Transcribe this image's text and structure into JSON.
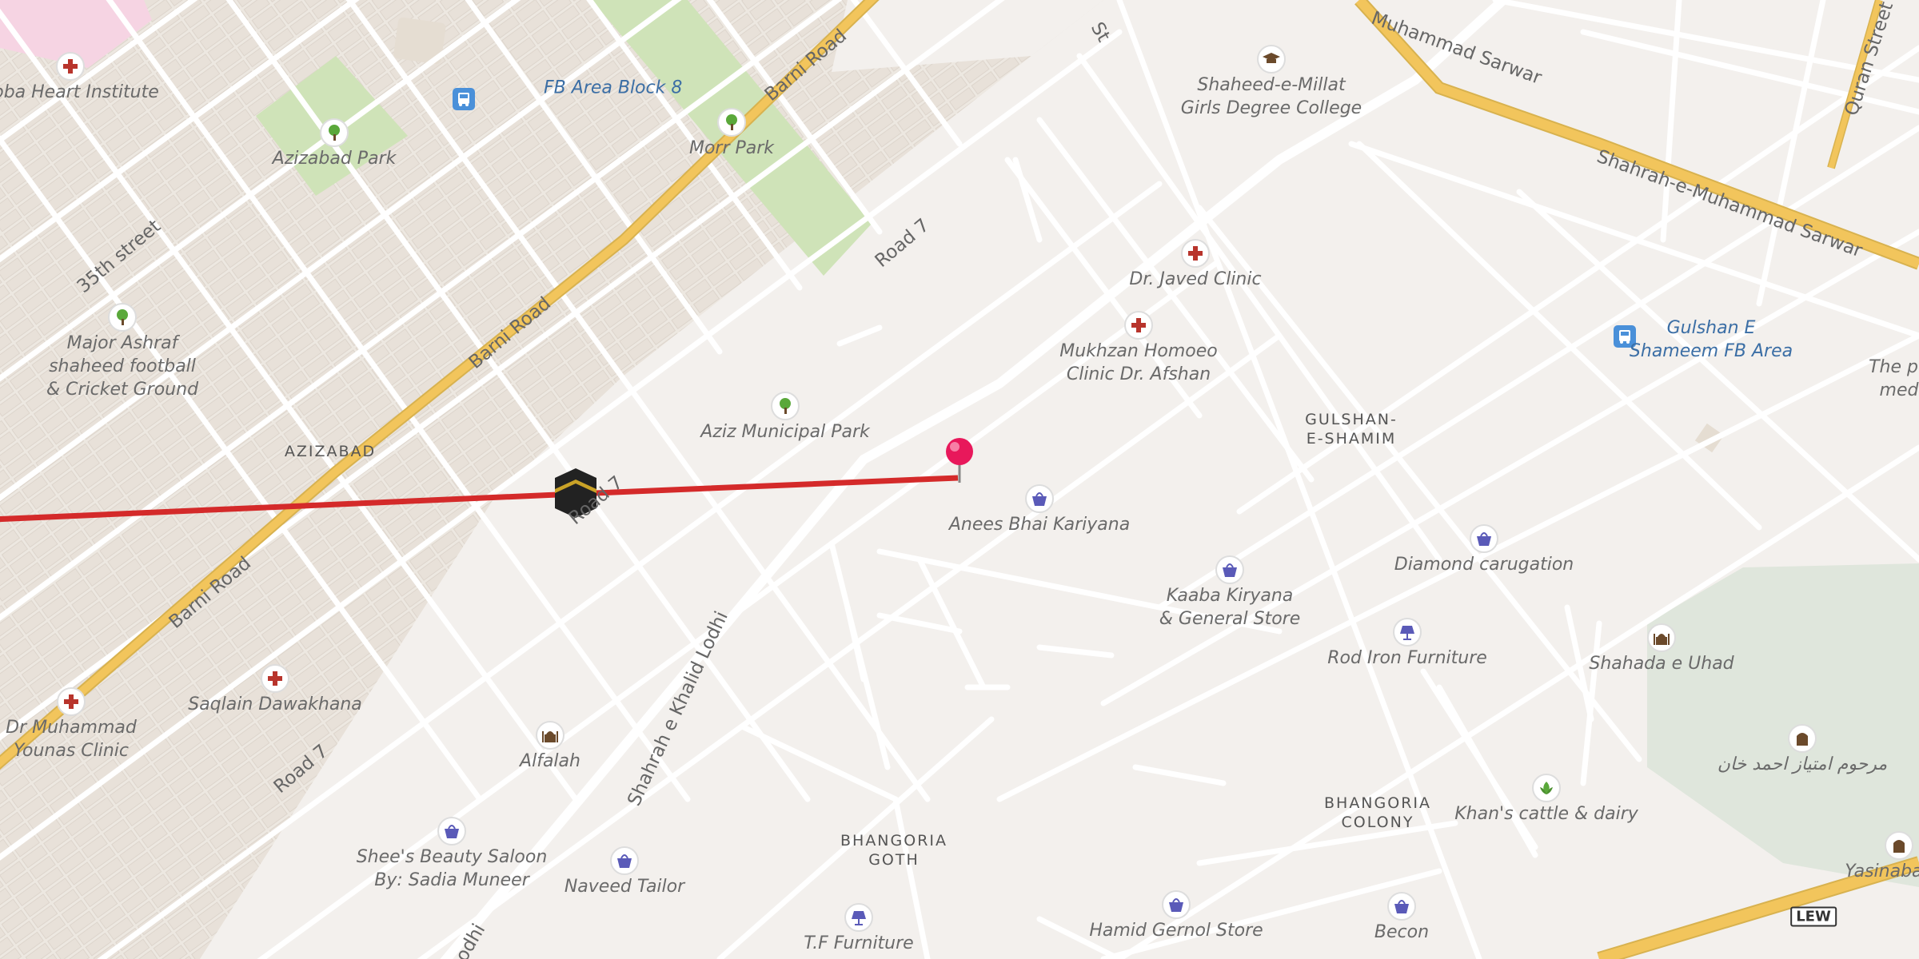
{
  "map": {
    "pois": [
      {
        "name": "heart-institute-icon",
        "type": "hospital",
        "label": "abba Heart Institute"
      },
      {
        "name": "fb-area-block8-icon",
        "type": "bus",
        "label": "FB Area Block 8"
      },
      {
        "name": "azizabad-park-icon",
        "type": "park",
        "label": "Azizabad Park"
      },
      {
        "name": "morr-park-icon",
        "type": "park",
        "label": "Morr Park"
      },
      {
        "name": "shaheed-millat-college-icon",
        "type": "school",
        "label": "Shaheed-e-Millat\nGirls Degree College"
      },
      {
        "name": "dr-javed-clinic-icon",
        "type": "hospital",
        "label": "Dr. Javed Clinic"
      },
      {
        "name": "mukhzan-homoeo-clinic-icon",
        "type": "hospital",
        "label": "Mukhzan Homoeo\nClinic Dr. Afshan"
      },
      {
        "name": "gulshan-shameem-fb-area-icon",
        "type": "bus",
        "label": "Gulshan E\nShameem FB Area"
      },
      {
        "name": "major-ashraf-ground-icon",
        "type": "park",
        "label": "Major Ashraf\nshaheed football\n& Cricket Ground"
      },
      {
        "name": "aziz-municipal-park-icon",
        "type": "park",
        "label": "Aziz Municipal Park"
      },
      {
        "name": "anees-bhai-kariyana-icon",
        "type": "shop",
        "label": "Anees Bhai Kariyana"
      },
      {
        "name": "diamond-carugation-icon",
        "type": "shop",
        "label": "Diamond carugation"
      },
      {
        "name": "kaaba-kiryana-icon",
        "type": "shop",
        "label": "Kaaba Kiryana\n& General Store"
      },
      {
        "name": "rod-iron-furniture-icon",
        "type": "lamp",
        "label": "Rod Iron Furniture"
      },
      {
        "name": "shahada-e-uhad-icon",
        "type": "mosque",
        "label": "Shahada e Uhad"
      },
      {
        "name": "saqlain-dawakhana-icon",
        "type": "hospital",
        "label": "Saqlain Dawakhana"
      },
      {
        "name": "dr-muhammad-younas-clinic-icon",
        "type": "hospital",
        "label": "Dr Muhammad\nYounas Clinic"
      },
      {
        "name": "alfalah-icon",
        "type": "mosque",
        "label": "Alfalah"
      },
      {
        "name": "urdu-tomb-icon",
        "type": "tomb",
        "label": "مرحوم امتیاز احمد خان"
      },
      {
        "name": "khans-cattle-dairy-icon",
        "type": "farm",
        "label": "Khan's cattle & dairy"
      },
      {
        "name": "shees-beauty-saloon-icon",
        "type": "shop",
        "label": "Shee's Beauty Saloon\nBy: Sadia Muneer"
      },
      {
        "name": "naveed-tailor-icon",
        "type": "shop",
        "label": "Naveed Tailor"
      },
      {
        "name": "tf-furniture-icon",
        "type": "lamp",
        "label": "T.F Furniture"
      },
      {
        "name": "hamid-gernol-store-icon",
        "type": "shop",
        "label": "Hamid Gernol Store"
      },
      {
        "name": "becon-icon",
        "type": "shop",
        "label": "Becon"
      },
      {
        "name": "yasinabad-icon",
        "type": "tomb",
        "label": "Yasinabad Q"
      },
      {
        "name": "the-pu-med-icon",
        "type": "none",
        "label": "The pu\nmed"
      }
    ],
    "areas": [
      {
        "name": "area-azizabad",
        "label": "AZIZABAD"
      },
      {
        "name": "area-gulshan-e-shamim",
        "label": "GULSHAN-\nE-SHAMIM"
      },
      {
        "name": "area-bhangoria-goth",
        "label": "BHANGORIA\nGOTH"
      },
      {
        "name": "area-bhangoria-colony",
        "label": "BHANGORIA\nCOLONY"
      }
    ],
    "roads": [
      {
        "name": "road-label-barni-road-top",
        "label": "Barni Road"
      },
      {
        "name": "road-label-barni-road-mid",
        "label": "Barni Road"
      },
      {
        "name": "road-label-barni-road-bottom",
        "label": "Barni Road"
      },
      {
        "name": "road-label-road7-top",
        "label": "Road 7"
      },
      {
        "name": "road-label-road7-mid",
        "label": "Road 7"
      },
      {
        "name": "road-label-road7-bottom",
        "label": "Road 7"
      },
      {
        "name": "road-label-35th-street",
        "label": "35th street"
      },
      {
        "name": "road-label-shahrah-khalid-lodhi",
        "label": "Shahrah e Khalid Lodhi"
      },
      {
        "name": "road-label-lodhi",
        "label": "Lodhi"
      },
      {
        "name": "road-label-shahrah-muhammad-sarwar",
        "label": "Shahrah-e-Muhammad Sarwar"
      },
      {
        "name": "road-label-muhammad-sarwar-top",
        "label": "Muhammad Sarwar"
      },
      {
        "name": "road-label-quran-street",
        "label": "Quran Street"
      },
      {
        "name": "road-label-st",
        "label": "St"
      }
    ],
    "shield": "LEW",
    "colors": {
      "route": "#d42a2a",
      "major_road": "#f2c55c",
      "park": "#cfe3b8",
      "hospital_pink": "#f6d4e3",
      "icon_purple": "#5a5ab8",
      "hospital_red": "#b8342c"
    }
  }
}
